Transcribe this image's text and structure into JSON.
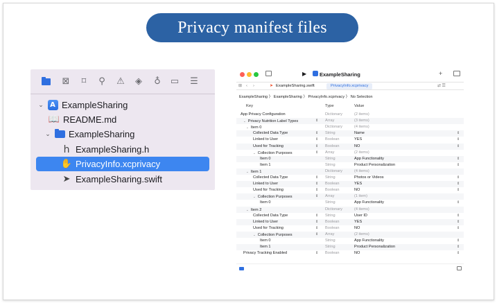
{
  "title": "Privacy manifest files",
  "navigator": {
    "toolbar_icons": [
      "folder-icon",
      "x-square-icon",
      "bookmark-icon",
      "search-icon",
      "warning-icon",
      "diamond-icon",
      "spray-icon",
      "capsule-icon",
      "list-icon"
    ],
    "items": [
      {
        "chevron": "⌄",
        "icon": "app-icon",
        "label": "ExampleSharing"
      },
      {
        "chevron": "",
        "icon": "book-icon",
        "label": "README.md"
      },
      {
        "chevron": "⌄",
        "icon": "folder-icon",
        "label": "ExampleSharing"
      },
      {
        "chevron": "",
        "icon": "h-icon",
        "label": "ExampleSharing.h"
      },
      {
        "chevron": "",
        "icon": "hand-icon",
        "label": "PrivacyInfo.xcprivacy",
        "selected": true
      },
      {
        "chevron": "",
        "icon": "swift-icon",
        "label": "ExampleSharing.swift"
      }
    ]
  },
  "editor": {
    "window_title": "ExampleSharing",
    "tabs": [
      "ExampleSharing.swift",
      "PrivacyInfo.xcprivacy"
    ],
    "jump_bar": "ExampleSharing 〉 ExampleSharing 〉 PrivacyInfo.xcprivacy 〉 No Selection",
    "columns": {
      "key": "Key",
      "type": "Type",
      "value": "Value"
    },
    "rows": [
      {
        "key": "App Privacy Configuration",
        "type": "Dictionary",
        "value": "(2 items)"
      },
      {
        "key": "Privacy Nutrition Label Types",
        "type": "Array",
        "value": "(3 items)"
      },
      {
        "key": "Item 0",
        "type": "Dictionary",
        "value": "(4 items)"
      },
      {
        "key": "Collected Data Type",
        "type": "String",
        "value": "Name"
      },
      {
        "key": "Linked to User",
        "type": "Boolean",
        "value": "YES"
      },
      {
        "key": "Used for Tracking",
        "type": "Boolean",
        "value": "NO"
      },
      {
        "key": "Collection Purposes",
        "type": "Array",
        "value": "(2 items)"
      },
      {
        "key": "Item 0",
        "type": "String",
        "value": "App Functionality"
      },
      {
        "key": "Item 1",
        "type": "String",
        "value": "Product Personalization"
      },
      {
        "key": "Item 1",
        "type": "Dictionary",
        "value": "(4 items)"
      },
      {
        "key": "Collected Data Type",
        "type": "String",
        "value": "Photos or Videos"
      },
      {
        "key": "Linked to User",
        "type": "Boolean",
        "value": "YES"
      },
      {
        "key": "Used for Tracking",
        "type": "Boolean",
        "value": "NO"
      },
      {
        "key": "Collection Purposes",
        "type": "Array",
        "value": "(1 item)"
      },
      {
        "key": "Item 0",
        "type": "String",
        "value": "App Functionality"
      },
      {
        "key": "Item 2",
        "type": "Dictionary",
        "value": "(4 items)"
      },
      {
        "key": "Collected Data Type",
        "type": "String",
        "value": "User ID"
      },
      {
        "key": "Linked to User",
        "type": "Boolean",
        "value": "YES"
      },
      {
        "key": "Used for Tracking",
        "type": "Boolean",
        "value": "NO"
      },
      {
        "key": "Collection Purposes",
        "type": "Array",
        "value": "(2 items)"
      },
      {
        "key": "Item 0",
        "type": "String",
        "value": "App Functionality"
      },
      {
        "key": "Item 1",
        "type": "String",
        "value": "Product Personalization"
      },
      {
        "key": "Privacy Tracking Enabled",
        "type": "Boolean",
        "value": "NO"
      }
    ]
  },
  "colors": {
    "title_pill": "#2c62a4",
    "selection": "#3d86f0",
    "accent": "#2f6fe0"
  }
}
